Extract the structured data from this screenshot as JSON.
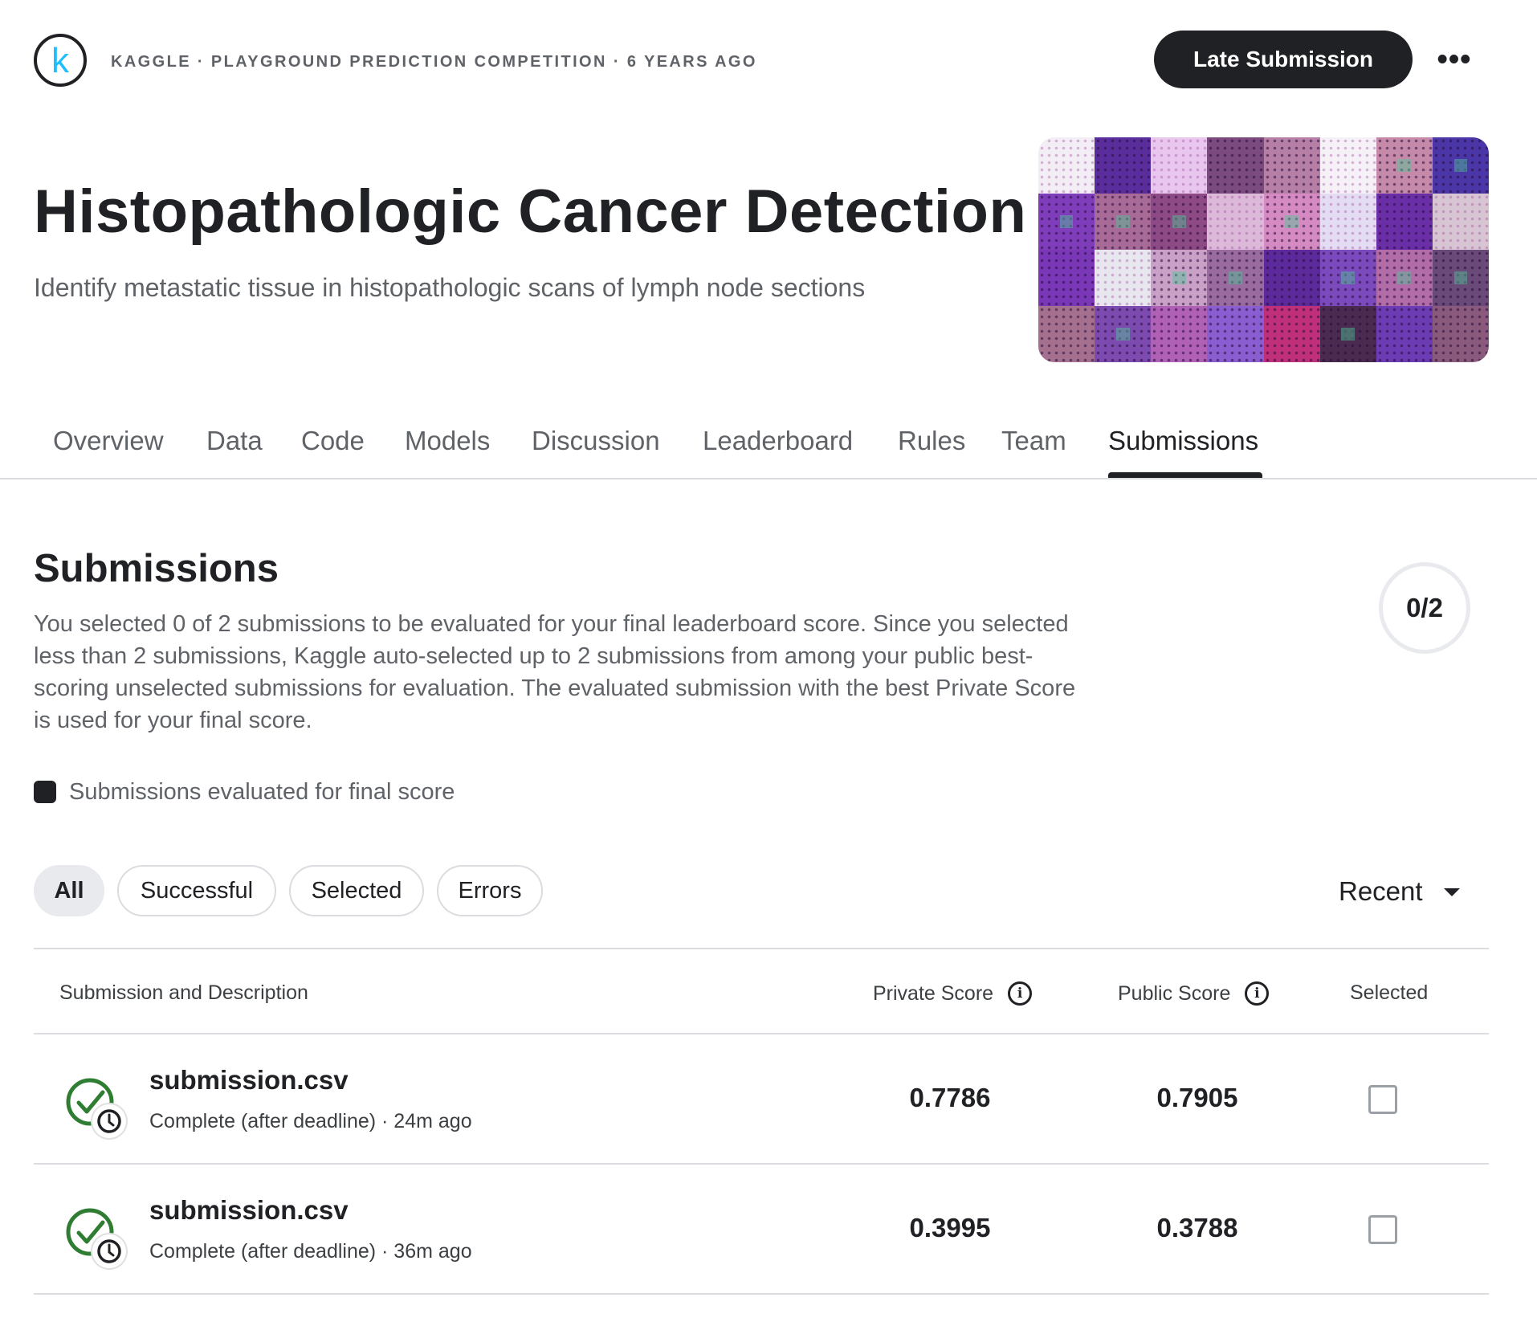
{
  "header": {
    "logo_letter": "k",
    "breadcrumb": "KAGGLE · PLAYGROUND PREDICTION COMPETITION · 6 YEARS AGO",
    "late_submission_label": "Late Submission",
    "more_label": "•••"
  },
  "hero": {
    "title": "Histopathologic Cancer Detection",
    "subtitle": "Identify metastatic tissue in histopathologic scans of lymph node sections"
  },
  "tabs": [
    {
      "label": "Overview",
      "active": false
    },
    {
      "label": "Data",
      "active": false
    },
    {
      "label": "Code",
      "active": false
    },
    {
      "label": "Models",
      "active": false
    },
    {
      "label": "Discussion",
      "active": false
    },
    {
      "label": "Leaderboard",
      "active": false
    },
    {
      "label": "Rules",
      "active": false
    },
    {
      "label": "Team",
      "active": false
    },
    {
      "label": "Submissions",
      "active": true
    }
  ],
  "submissions": {
    "title": "Submissions",
    "description": "You selected 0 of 2 submissions to be evaluated for your final leaderboard score. Since you selected less than 2 submissions, Kaggle auto-selected up to 2 submissions from among your public best-scoring unselected submissions for evaluation. The evaluated submission with the best Private Score is used for your final score.",
    "counter": "0/2",
    "legend": "Submissions evaluated for final score"
  },
  "filters": {
    "chips": [
      {
        "label": "All",
        "active": true
      },
      {
        "label": "Successful",
        "active": false
      },
      {
        "label": "Selected",
        "active": false
      },
      {
        "label": "Errors",
        "active": false
      }
    ],
    "sort_label": "Recent"
  },
  "table": {
    "headers": {
      "submission": "Submission and Description",
      "private": "Private Score",
      "public": "Public Score",
      "selected": "Selected",
      "info_glyph": "i"
    },
    "rows": [
      {
        "name": "submission.csv",
        "meta": "Complete (after deadline) · 24m ago",
        "private": "0.7786",
        "public": "0.7905",
        "selected": false
      },
      {
        "name": "submission.csv",
        "meta": "Complete (after deadline) · 36m ago",
        "private": "0.3995",
        "public": "0.3788",
        "selected": false
      }
    ]
  },
  "colors": {
    "primary": "#202124",
    "muted": "#5f6368",
    "border": "#dadce0",
    "success": "#2e7d32",
    "kaggle_blue": "#20beff"
  },
  "icons": {
    "logo": "kaggle-logo",
    "more": "more-horizontal-icon",
    "info": "info-icon",
    "status": "check-clock-icon",
    "sort": "caret-down-icon"
  }
}
